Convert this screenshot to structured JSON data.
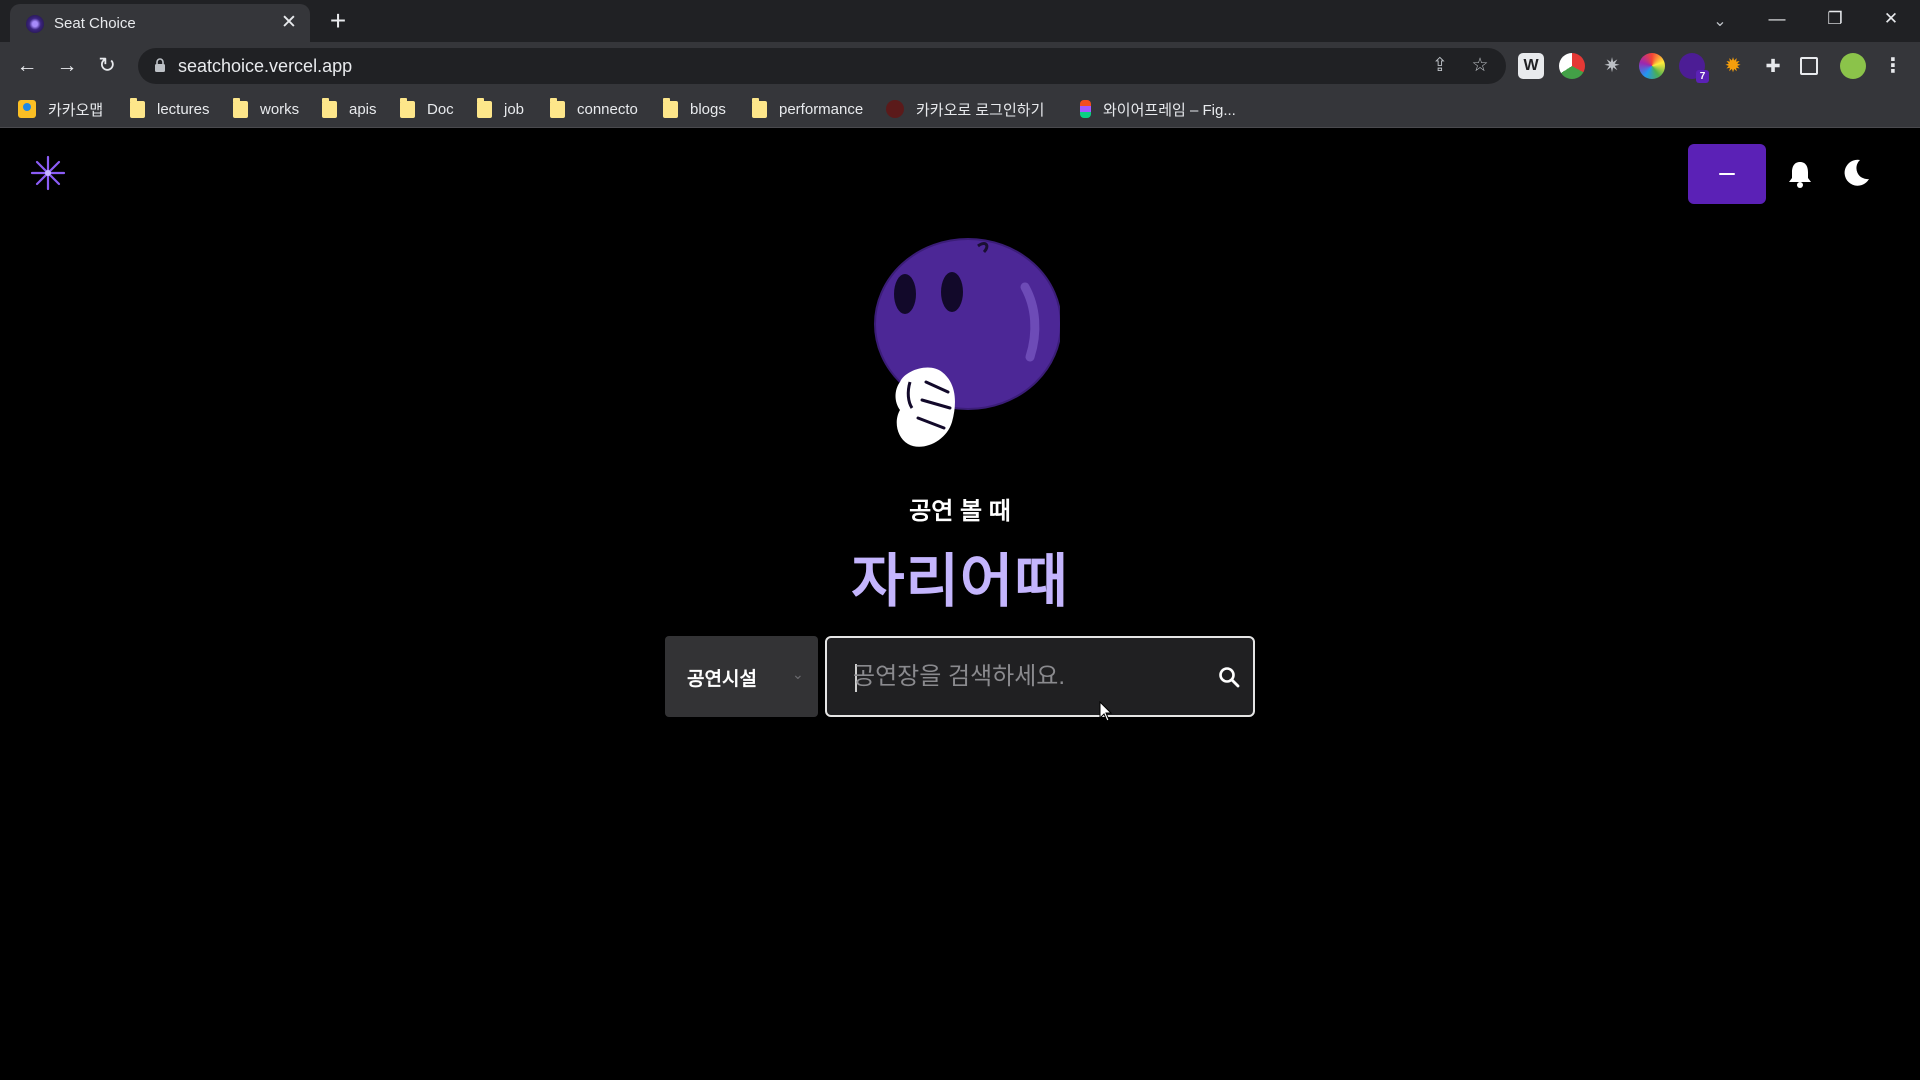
{
  "browser": {
    "tab_title": "Seat Choice",
    "url": "seatchoice.vercel.app",
    "extension_badge": "7",
    "bookmarks": [
      {
        "label": "카카오맵",
        "type": "site"
      },
      {
        "label": "lectures",
        "type": "folder"
      },
      {
        "label": "works",
        "type": "folder"
      },
      {
        "label": "apis",
        "type": "folder"
      },
      {
        "label": "Doc",
        "type": "folder"
      },
      {
        "label": "job",
        "type": "folder"
      },
      {
        "label": "connecto",
        "type": "folder"
      },
      {
        "label": "blogs",
        "type": "folder"
      },
      {
        "label": "performance",
        "type": "folder"
      },
      {
        "label": "카카오로 로그인하기",
        "type": "site"
      },
      {
        "label": "와이어프레임 – Fig...",
        "type": "site"
      }
    ]
  },
  "header": {
    "accent_color": "#5b21b6"
  },
  "hero": {
    "subtitle": "공연 볼 때",
    "brand": "자리어때",
    "brand_color": "#c4b5fd"
  },
  "search": {
    "category": "공연시설",
    "placeholder": "공연장을 검색하세요."
  }
}
